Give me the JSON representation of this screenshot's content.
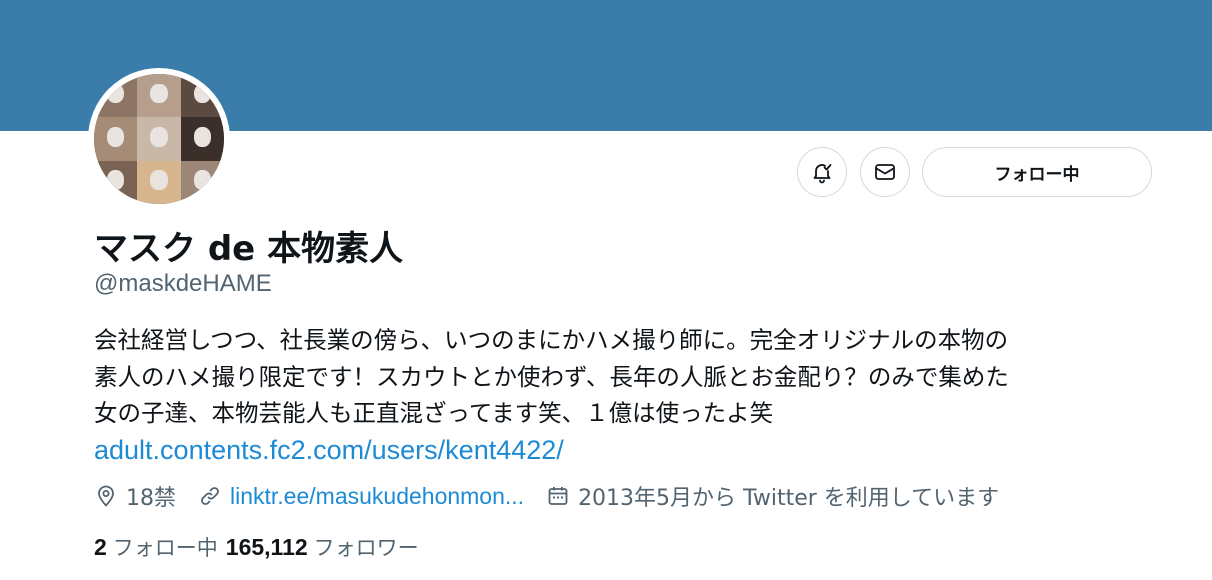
{
  "profile": {
    "display_name": "マスク de 本物素人",
    "handle": "@maskdeHAME",
    "bio_lines": [
      "会社経営しつつ、社長業の傍ら、いつのまにかハメ撮り師に。完全オリジナルの本物の",
      "素人のハメ撮り限定です！スカウトとか使わず、長年の人脈とお金配り？のみで集めた",
      "女の子達、本物芸能人も正直混ざってます笑、１億は使ったよ笑"
    ],
    "bio_link": "adult.contents.fc2.com/users/kent4422/"
  },
  "actions": {
    "notify_icon": "bell-check-icon",
    "message_icon": "mail-icon",
    "follow_label": "フォロー中"
  },
  "meta": {
    "location": "18禁",
    "website": "linktr.ee/masukudehonmon...",
    "joined": "2013年5月から Twitter を利用しています"
  },
  "stats": {
    "following_count": "2",
    "following_label": "フォロー中",
    "followers_count": "165,112",
    "followers_label": "フォロワー"
  },
  "colors": {
    "banner": "#3a7dab",
    "link": "#1d8ad6",
    "secondary_text": "#536471"
  }
}
